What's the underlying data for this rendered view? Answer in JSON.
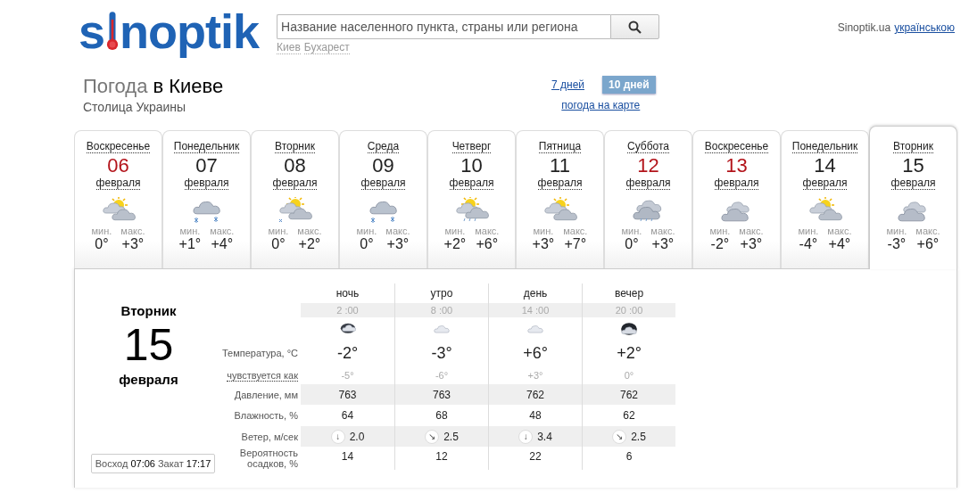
{
  "header": {
    "logo_before": "s",
    "logo_after": "noptik",
    "search": {
      "placeholder": "Название населенного пункта, страны или региона"
    },
    "recent_cities": [
      "Киев",
      "Бухарест"
    ],
    "site": "Sinoptik.ua",
    "language_link": "українською"
  },
  "title": {
    "prefix": "Погода",
    "city": "в Киеве",
    "subtitle": "Столица Украины",
    "range_tabs": [
      {
        "label": "7 дней",
        "selected": false
      },
      {
        "label": "10 дней",
        "selected": true
      }
    ],
    "map_link": "погода на карте"
  },
  "days": [
    {
      "weekday": "Воскресенье",
      "date": "06",
      "month": "февраля",
      "kind": "sun-cloud",
      "min_label": "мин.",
      "min": "0°",
      "max_label": "макс.",
      "max": "+3°",
      "weekend": true,
      "selected": false
    },
    {
      "weekday": "Понедельник",
      "date": "07",
      "month": "февраля",
      "kind": "snow",
      "min_label": "мин.",
      "min": "+1°",
      "max_label": "макс.",
      "max": "+4°",
      "weekend": false,
      "selected": false
    },
    {
      "weekday": "Вторник",
      "date": "08",
      "month": "февраля",
      "kind": "sun-snow",
      "min_label": "мин.",
      "min": "0°",
      "max_label": "макс.",
      "max": "+2°",
      "weekend": false,
      "selected": false
    },
    {
      "weekday": "Среда",
      "date": "09",
      "month": "февраля",
      "kind": "snow",
      "min_label": "мин.",
      "min": "0°",
      "max_label": "макс.",
      "max": "+3°",
      "weekend": false,
      "selected": false
    },
    {
      "weekday": "Четверг",
      "date": "10",
      "month": "февраля",
      "kind": "sun-rain",
      "min_label": "мин.",
      "min": "+2°",
      "max_label": "макс.",
      "max": "+6°",
      "weekend": false,
      "selected": false
    },
    {
      "weekday": "Пятница",
      "date": "11",
      "month": "февраля",
      "kind": "sun-cloud",
      "min_label": "мин.",
      "min": "+3°",
      "max_label": "макс.",
      "max": "+7°",
      "weekend": false,
      "selected": false
    },
    {
      "weekday": "Суббота",
      "date": "12",
      "month": "февраля",
      "kind": "rain",
      "min_label": "мин.",
      "min": "0°",
      "max_label": "макс.",
      "max": "+3°",
      "weekend": true,
      "selected": false
    },
    {
      "weekday": "Воскресенье",
      "date": "13",
      "month": "февраля",
      "kind": "cloud",
      "min_label": "мин.",
      "min": "-2°",
      "max_label": "макс.",
      "max": "+3°",
      "weekend": true,
      "selected": false
    },
    {
      "weekday": "Понедельник",
      "date": "14",
      "month": "февраля",
      "kind": "sun-cloud",
      "min_label": "мин.",
      "min": "-4°",
      "max_label": "макс.",
      "max": "+4°",
      "weekend": false,
      "selected": false
    },
    {
      "weekday": "Вторник",
      "date": "15",
      "month": "февраля",
      "kind": "cloud",
      "min_label": "мин.",
      "min": "-3°",
      "max_label": "макс.",
      "max": "+6°",
      "weekend": false,
      "selected": true
    }
  ],
  "detail": {
    "weekday": "Вторник",
    "date": "15",
    "month": "февраля",
    "sunrise_label": "Восход",
    "sunrise": "07:06",
    "sunset_label": "Закат",
    "sunset": "17:17",
    "labels": {
      "temperature": "Температура, °C",
      "feels": "чувствуется как",
      "pressure": "Давление, мм",
      "humidity": "Влажность, %",
      "wind": "Ветер, м/сек",
      "precip": "Вероятность осадков, %"
    },
    "periods": [
      {
        "name": "ночь",
        "time": "2 :00",
        "kind": "moon-cloud",
        "temp": "-2°",
        "feels": "-5°",
        "pressure": "763",
        "humidity": "64",
        "wind_dir": "↓",
        "wind": "2.0",
        "precip": "14"
      },
      {
        "name": "утро",
        "time": "8 :00",
        "kind": "small-cloud",
        "temp": "-3°",
        "feels": "-6°",
        "pressure": "763",
        "humidity": "68",
        "wind_dir": "↘",
        "wind": "2.5",
        "precip": "12"
      },
      {
        "name": "день",
        "time": "14 :00",
        "kind": "small-cloud",
        "temp": "+6°",
        "feels": "+3°",
        "pressure": "762",
        "humidity": "48",
        "wind_dir": "↓",
        "wind": "3.4",
        "precip": "22"
      },
      {
        "name": "вечер",
        "time": "20 :00",
        "kind": "night-cloud",
        "temp": "+2°",
        "feels": "0°",
        "pressure": "762",
        "humidity": "62",
        "wind_dir": "↘",
        "wind": "2.5",
        "precip": "6"
      }
    ]
  }
}
